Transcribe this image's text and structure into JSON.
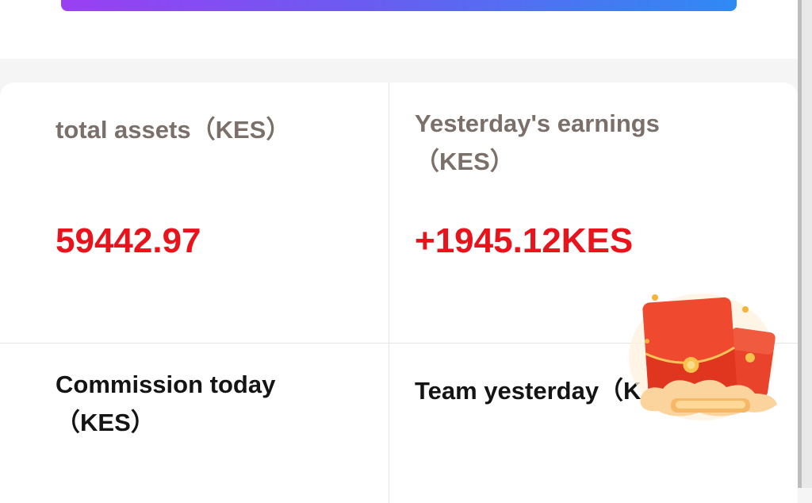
{
  "stats": {
    "total_assets": {
      "label": "total assets（KES）",
      "value": "59442.97"
    },
    "yesterday_earnings": {
      "label_line1": "Yesterday's earnings",
      "label_line2": "（KES）",
      "value": "+1945.12KES"
    },
    "commission_today": {
      "label_line1": "Commission today",
      "label_line2": "（KES）"
    },
    "team_yesterday": {
      "label": "Team yesterday（K"
    }
  },
  "colors": {
    "accent_red": "#e8131b",
    "muted_label": "#7b6f6a",
    "gradient_start": "#9a3ff3",
    "gradient_end": "#2f8af4"
  },
  "icons": {
    "floating_promo": "red-envelope-icon"
  }
}
